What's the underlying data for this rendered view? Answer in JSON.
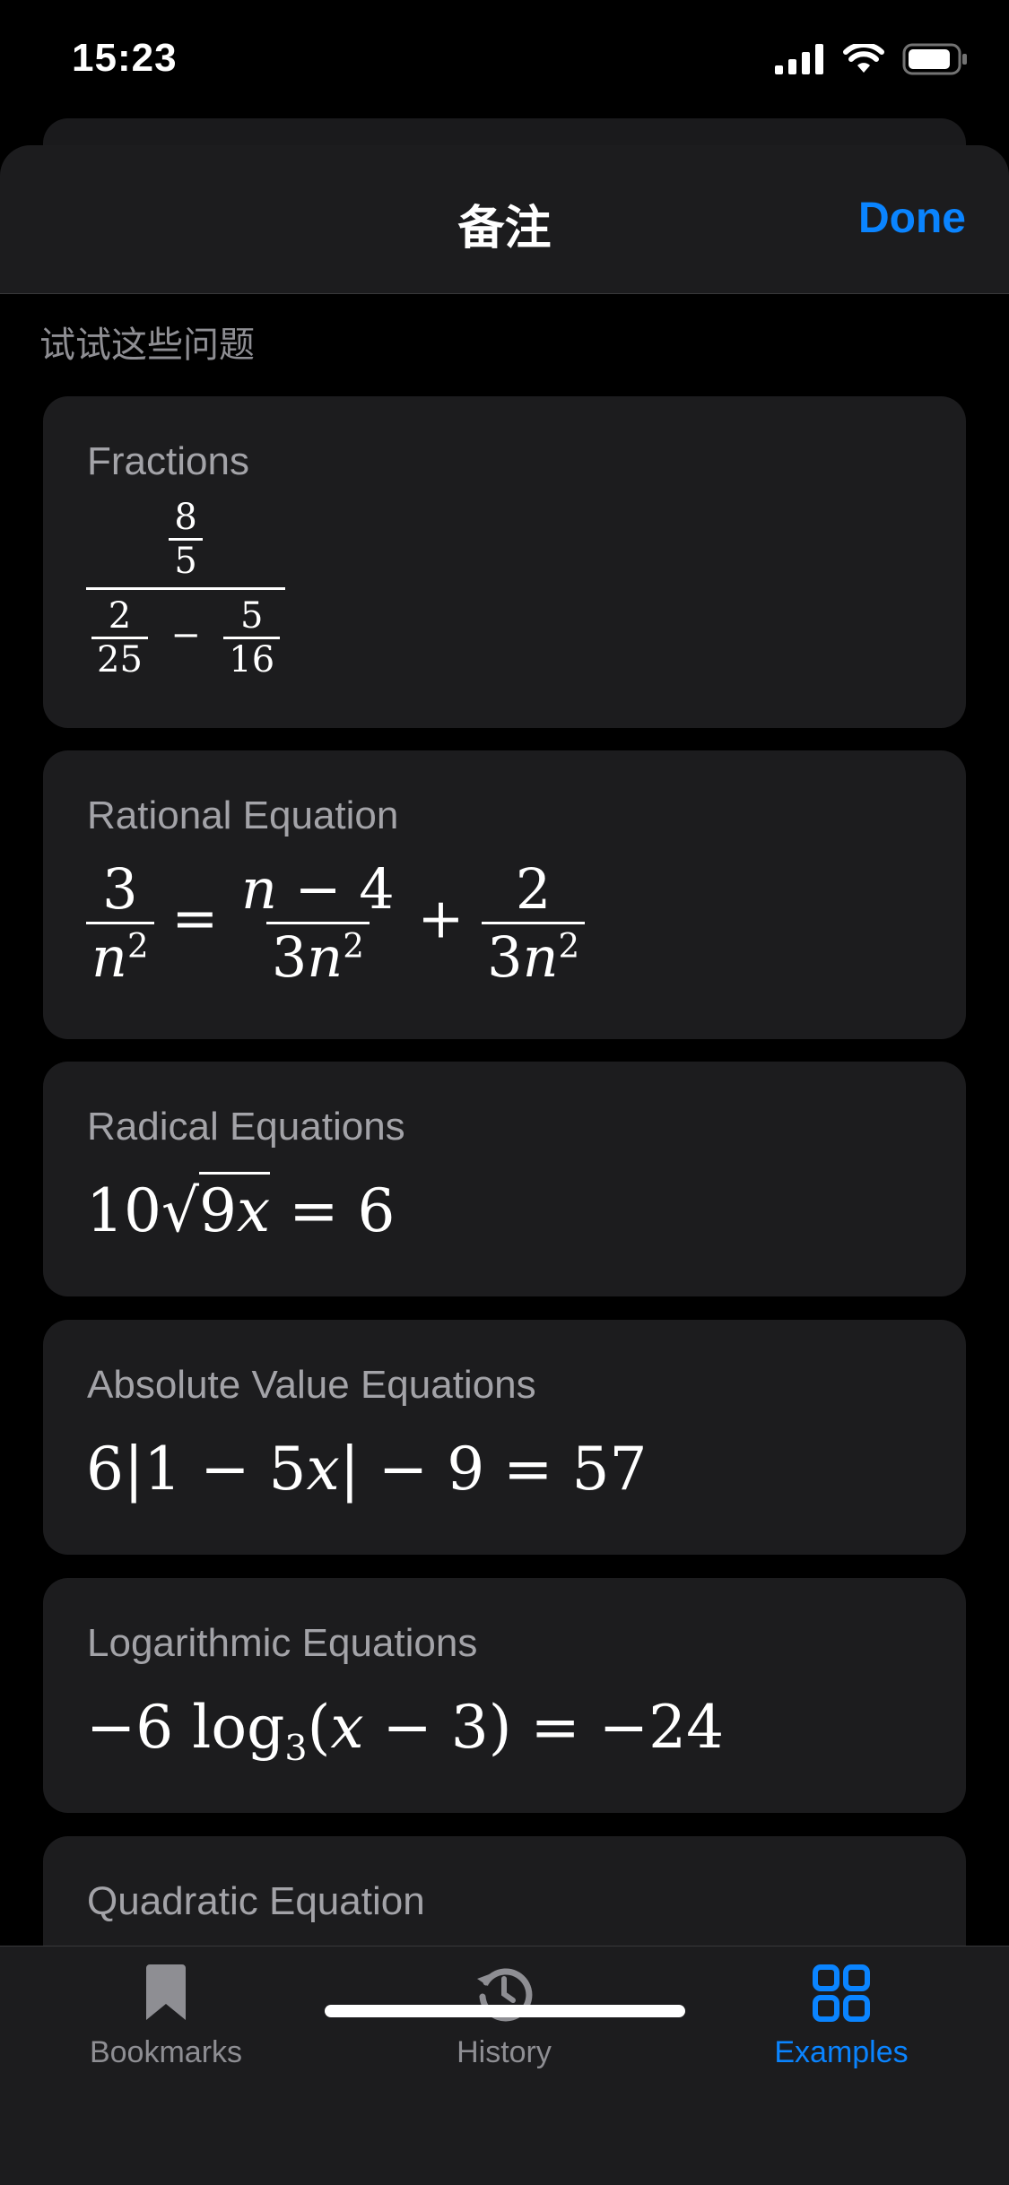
{
  "status": {
    "time": "15:23"
  },
  "nav": {
    "title": "备注",
    "done_label": "Done"
  },
  "section_title": "试试这些问题",
  "examples": [
    {
      "title": "Fractions"
    },
    {
      "title": "Rational Equation"
    },
    {
      "title": "Radical Equations"
    },
    {
      "title": "Absolute Value Equations"
    },
    {
      "title": "Logarithmic Equations"
    },
    {
      "title": "Quadratic Equation"
    }
  ],
  "tabs": [
    {
      "label": "Bookmarks",
      "icon": "bookmark-icon"
    },
    {
      "label": "History",
      "icon": "history-icon"
    },
    {
      "label": "Examples",
      "icon": "grid-icon",
      "selected": true
    }
  ],
  "colors": {
    "accent": "#0a84ff",
    "card": "#1c1c1e",
    "secondary_text": "#8e8e93"
  }
}
